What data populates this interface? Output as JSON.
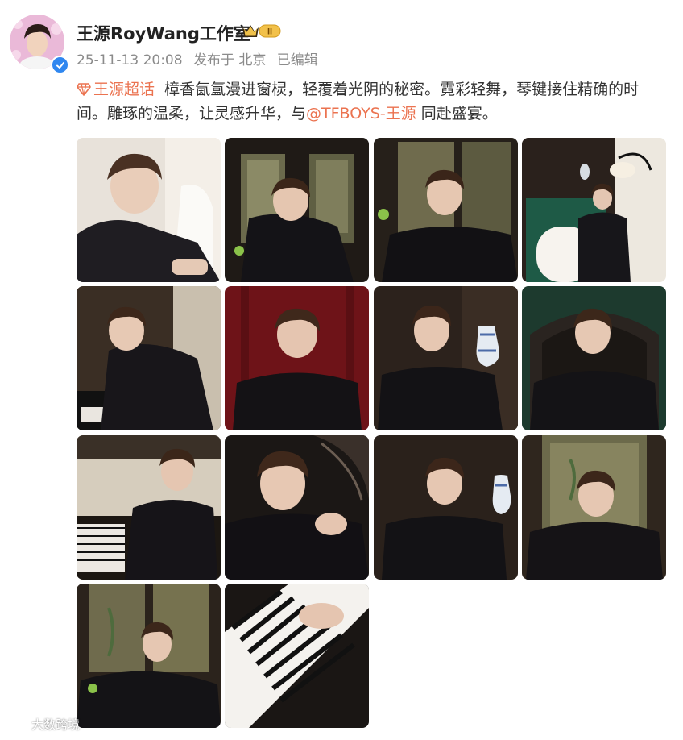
{
  "post": {
    "author": "王源RoyWang工作室",
    "badge_level": "II",
    "timestamp": "25-11-13 20:08",
    "location": "发布于 北京",
    "edited": "已编辑",
    "topic": "王源超话",
    "text_main": "樟香氤氲漫进窗棂，轻覆着光阴的秘密。霓彩轻舞，琴键接住精确的时间。雕琢的温柔，让灵感升华，与",
    "mention": "@TFBOYS-王源",
    "text_end": "同赴盛宴。"
  },
  "photos": [
    {
      "alt": "photo-1"
    },
    {
      "alt": "photo-2"
    },
    {
      "alt": "photo-3"
    },
    {
      "alt": "photo-4"
    },
    {
      "alt": "photo-5"
    },
    {
      "alt": "photo-6"
    },
    {
      "alt": "photo-7"
    },
    {
      "alt": "photo-8"
    },
    {
      "alt": "photo-9"
    },
    {
      "alt": "photo-10"
    },
    {
      "alt": "photo-11"
    },
    {
      "alt": "photo-12"
    },
    {
      "alt": "photo-13"
    },
    {
      "alt": "photo-14"
    }
  ],
  "watermark": "大数跨境",
  "colors": {
    "accent": "#eb7350",
    "verified": "#2f87f0",
    "meta": "#8b8b8b"
  }
}
